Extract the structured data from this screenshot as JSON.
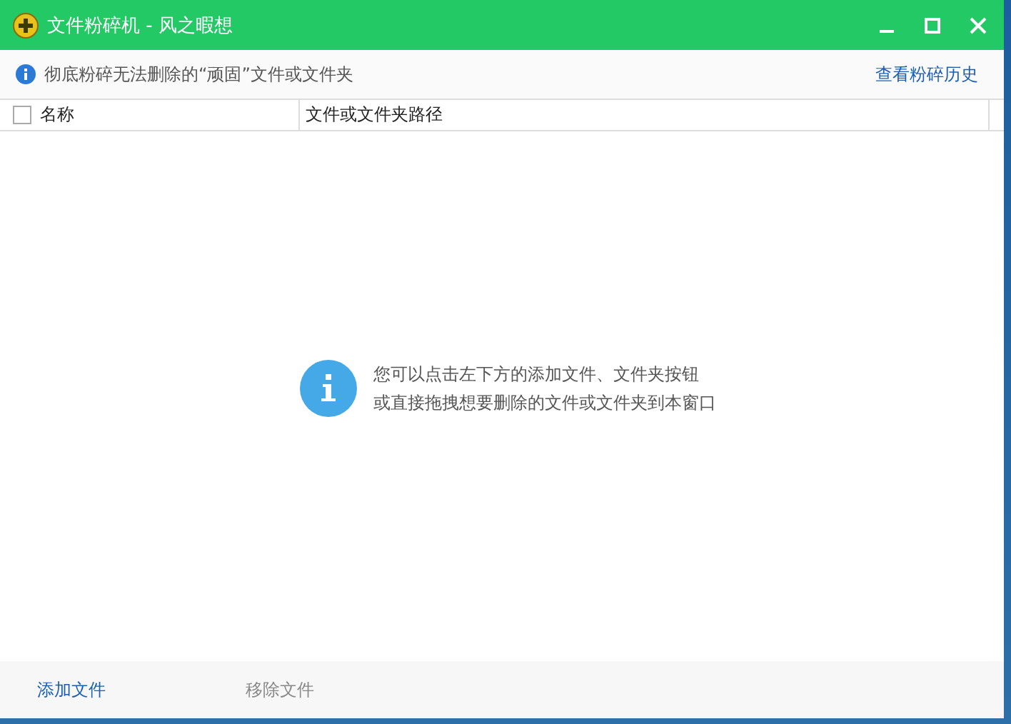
{
  "window": {
    "title": "文件粉碎机 - 风之暇想"
  },
  "info_bar": {
    "message": "彻底粉碎无法删除的“顽固”文件或文件夹",
    "history_link": "查看粉碎历史"
  },
  "table": {
    "select_all": {
      "checked": false
    },
    "columns": [
      "名称",
      "文件或文件夹路径"
    ]
  },
  "empty_state": {
    "lines": [
      "您可以点击左下方的添加文件、文件夹按钮",
      "或直接拖拽想要删除的文件或文件夹到本窗口"
    ]
  },
  "footer": {
    "buttons": [
      {
        "label": "添加文件",
        "disabled": false
      },
      {
        "label": "移除文件",
        "disabled": true
      }
    ]
  }
}
